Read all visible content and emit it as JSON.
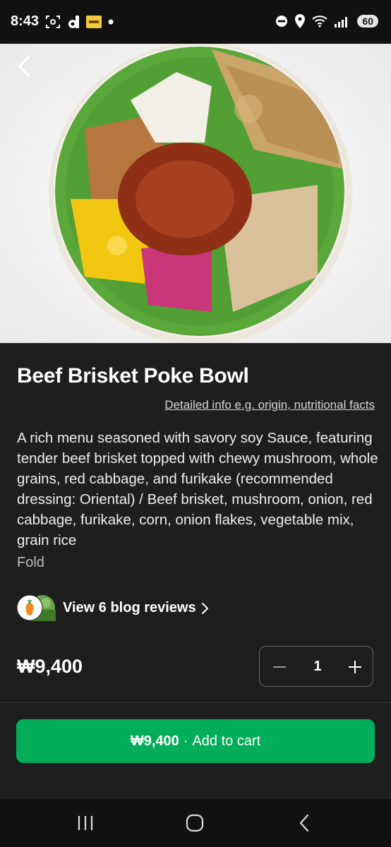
{
  "status_bar": {
    "time": "8:43",
    "battery": "60",
    "icons": [
      "screen-capture-icon",
      "d-app-icon",
      "app-badge-icon",
      "notification-dot-icon",
      "do-not-disturb-icon",
      "location-icon",
      "wifi-icon",
      "signal-icon"
    ]
  },
  "product": {
    "title": "Beef Brisket Poke Bowl",
    "info_link": "Detailed info e.g. origin, nutritional facts",
    "description": "A rich menu seasoned with savory soy Sauce, featuring tender beef brisket topped with chewy mushroom, whole grains, red cabbage, and furikake (recommended dressing: Oriental) / Beef brisket, mushroom, onion, red cabbage, furikake, corn, onion flakes, vegetable mix, grain rice",
    "fold_label": "Fold"
  },
  "reviews": {
    "label": "View 6 blog reviews"
  },
  "order": {
    "price": "₩9,400",
    "quantity": "1",
    "cart_price": "₩9,400",
    "cart_separator": "·",
    "cart_label": "Add to cart"
  },
  "colors": {
    "background": "#1e1e1f",
    "accent_green": "#03ad59"
  }
}
